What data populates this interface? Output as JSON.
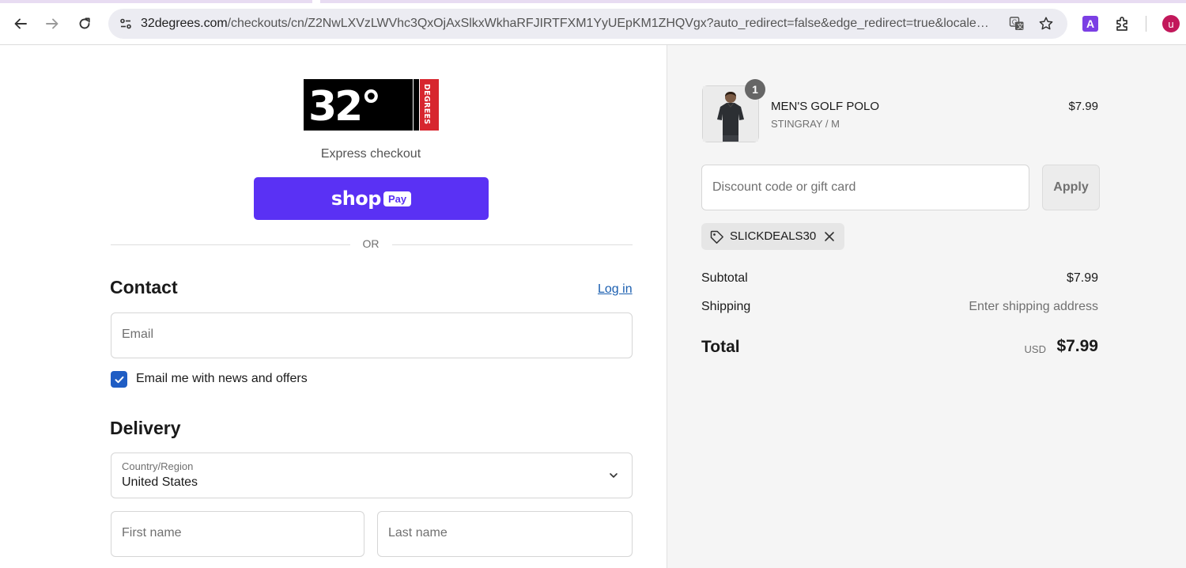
{
  "browser": {
    "url_host": "32degrees.com",
    "url_path": "/checkouts/cn/Z2NwLXVzLWVhc3QxOjAxSlkxWkhaRFJIRTFXM1YyUEpKM1ZHQVgx?auto_redirect=false&edge_redirect=true&locale=en-U...",
    "extension_label": "A",
    "avatar_initial": "u"
  },
  "brand": {
    "logo_text": "32°",
    "logo_side_text": "DEGREES"
  },
  "express": {
    "label": "Express checkout",
    "shoppay_shop": "shop",
    "shoppay_pay": "Pay",
    "or_label": "OR"
  },
  "contact": {
    "heading": "Contact",
    "login_link": "Log in",
    "email_placeholder": "Email",
    "newsletter_label": "Email me with news and offers",
    "newsletter_checked": true
  },
  "delivery": {
    "heading": "Delivery",
    "country_label": "Country/Region",
    "country_value": "United States",
    "first_name_placeholder": "First name",
    "last_name_placeholder": "Last name"
  },
  "summary": {
    "item": {
      "quantity": "1",
      "name": "MEN'S GOLF POLO",
      "variant": "STINGRAY / M",
      "price": "$7.99"
    },
    "discount_placeholder": "Discount code or gift card",
    "apply_label": "Apply",
    "applied_code": "SLICKDEALS30",
    "subtotal_label": "Subtotal",
    "subtotal_value": "$7.99",
    "shipping_label": "Shipping",
    "shipping_value": "Enter shipping address",
    "total_label": "Total",
    "total_currency": "USD",
    "total_value": "$7.99"
  },
  "colors": {
    "shoppay": "#5a31f4",
    "link": "#1b5fb0",
    "checkbox": "#1f5dc4",
    "logo_red": "#d7262e"
  }
}
